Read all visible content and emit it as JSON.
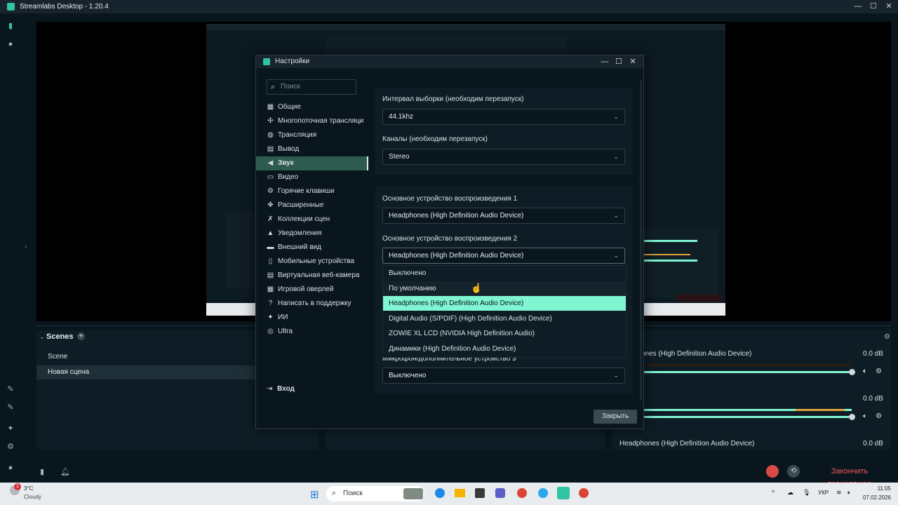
{
  "app": {
    "title": "Streamlabs Desktop - 1.20.4"
  },
  "scenes": {
    "header": "Scenes",
    "items": [
      "Scene",
      "Новая сцена"
    ]
  },
  "mixer": {
    "rows": [
      {
        "name": "ones (High Definition Audio Device)",
        "db": "0.0 dB"
      },
      {
        "name": "",
        "db": "0.0 dB"
      },
      {
        "name": "Headphones (High Definition Audio Device)",
        "db": "0.0 dB"
      }
    ]
  },
  "footer": {
    "end_stream": "Закончить трансляцию"
  },
  "taskbar": {
    "weather_temp": "3°C",
    "weather_desc": "Cloudy",
    "notif_count": "1",
    "search_placeholder": "Поиск",
    "lang": "УКР",
    "time": "11:05",
    "date": "07.02.2026"
  },
  "dialog": {
    "title": "Настройки",
    "search_placeholder": "Поиск",
    "menu": [
      {
        "label": "Общие",
        "icon": "grid-icon"
      },
      {
        "label": "Многопоточная трансляци",
        "icon": "multistream-icon"
      },
      {
        "label": "Трансляция",
        "icon": "globe-icon"
      },
      {
        "label": "Вывод",
        "icon": "output-icon"
      },
      {
        "label": "Звук",
        "icon": "speaker-icon"
      },
      {
        "label": "Видео",
        "icon": "video-icon"
      },
      {
        "label": "Горячие клавиши",
        "icon": "gear-icon"
      },
      {
        "label": "Расширенные",
        "icon": "advanced-icon"
      },
      {
        "label": "Коллекции сцен",
        "icon": "collections-icon"
      },
      {
        "label": "Уведомления",
        "icon": "bell-icon"
      },
      {
        "label": "Внешний вид",
        "icon": "appearance-icon"
      },
      {
        "label": "Мобильные устройства",
        "icon": "mobile-icon"
      },
      {
        "label": "Виртуальная веб-камера",
        "icon": "webcam-icon"
      },
      {
        "label": "Игровой оверлей",
        "icon": "overlay-icon"
      },
      {
        "label": "Написать в поддержку",
        "icon": "help-icon"
      },
      {
        "label": "ИИ",
        "icon": "ai-icon"
      },
      {
        "label": "Ultra",
        "icon": "ultra-icon"
      }
    ],
    "login_label": "Вход",
    "sample_rate": {
      "label": "Интервал выборки (необходим перезапуск)",
      "value": "44.1khz"
    },
    "channels": {
      "label": "Каналы (необходим перезапуск)",
      "value": "Stereo"
    },
    "desktop1": {
      "label": "Основное устройство воспроизведения 1",
      "value": "Headphones (High Definition Audio Device)"
    },
    "desktop2": {
      "label": "Основное устройство воспроизведения 2",
      "value": "Headphones (High Definition Audio Device)"
    },
    "dropdown_options": [
      "Выключено",
      "По умолчанию",
      "Headphones (High Definition Audio Device)",
      "Digital Audio (S/PDIF) (High Definition Audio Device)",
      "ZOWIE XL LCD (NVIDIA High Definition Audio)",
      "Динамики (High Definition Audio Device)"
    ],
    "mic3": {
      "label": "Микрофон/дополнительное устройство 3",
      "value": "Выключено"
    },
    "close_label": "Закрыть"
  },
  "colors": {
    "accent": "#80f5d2",
    "active_menu": "#2d5b4f",
    "end_stream": "#f25a5a"
  }
}
